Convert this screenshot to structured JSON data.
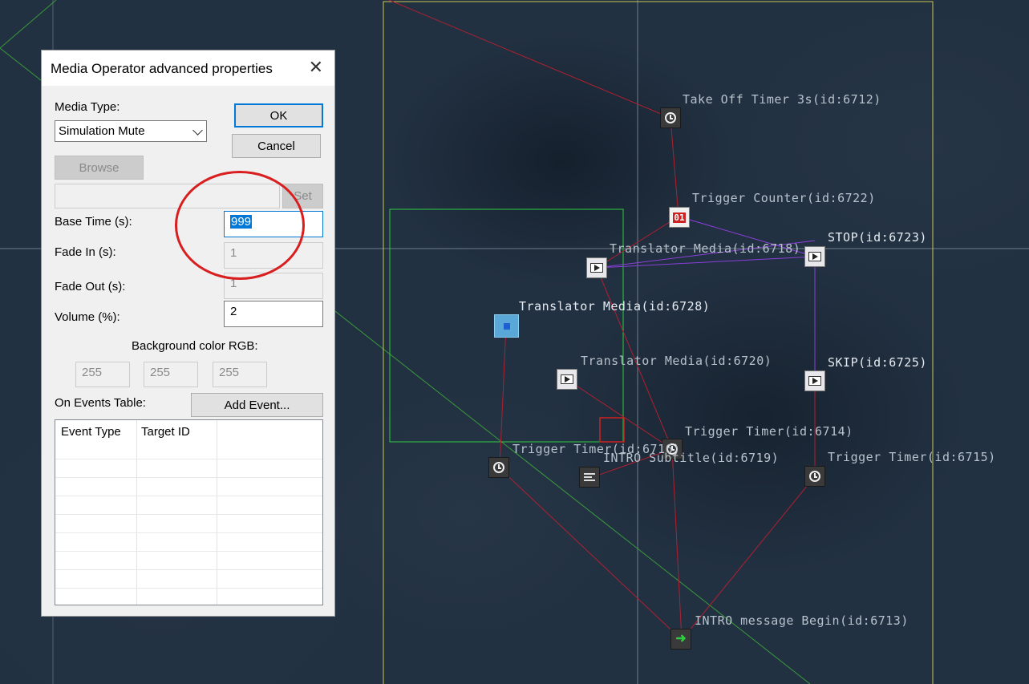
{
  "map": {
    "nodes": [
      {
        "name": "take-off-timer",
        "label": "Take Off Timer 3s(id:6712)",
        "icon": "timer-icon"
      },
      {
        "name": "trigger-counter",
        "label": "Trigger Counter(id:6722)",
        "icon": "counter-icon"
      },
      {
        "name": "translator-media-6718",
        "label": "Translator Media(id:6718)",
        "icon": "media-icon"
      },
      {
        "name": "stop",
        "label": "STOP(id:6723)",
        "icon": "media-icon"
      },
      {
        "name": "translator-media-6728",
        "label": "Translator Media(id:6728)",
        "icon": "media-selected-icon"
      },
      {
        "name": "translator-media-6720",
        "label": "Translator Media(id:6720)",
        "icon": "media-icon"
      },
      {
        "name": "skip",
        "label": "SKIP(id:6725)",
        "icon": "media-icon"
      },
      {
        "name": "trigger-timer-6714",
        "label": "Trigger Timer(id:6714)",
        "icon": "timer-icon"
      },
      {
        "name": "trigger-timer-6716",
        "label": "Trigger Timer(id:6716)",
        "icon": "timer-icon"
      },
      {
        "name": "intro-subtitle",
        "label": "INTRO Subtitle(id:6719)",
        "icon": "subtitle-icon"
      },
      {
        "name": "trigger-timer-6715",
        "label": "Trigger Timer(id:6715)",
        "icon": "timer-icon"
      },
      {
        "name": "intro-message-begin",
        "label": "INTRO message Begin(id:6713)",
        "icon": "entry-icon"
      }
    ],
    "counter_glyph": "01"
  },
  "dialog": {
    "title": "Media Operator advanced properties",
    "close_glyph": "✕",
    "media_type_label": "Media Type:",
    "media_type_value": "Simulation Mute",
    "ok_label": "OK",
    "cancel_label": "Cancel",
    "browse_label": "Browse",
    "path_value": "",
    "set_label": "Set",
    "base_time_label": "Base Time (s):",
    "base_time_value": "999",
    "fade_in_label": "Fade In (s):",
    "fade_in_value": "1",
    "fade_out_label": "Fade Out (s):",
    "fade_out_value": "1",
    "volume_label": "Volume (%):",
    "volume_value": "2",
    "bg_color_label": "Background color RGB:",
    "bg_r": "255",
    "bg_g": "255",
    "bg_b": "255",
    "events_label": "On Events Table:",
    "add_event_label": "Add Event...",
    "table_headers": [
      "Event Type",
      "Target ID"
    ]
  },
  "colors": {
    "annotation": "#d81e1e",
    "link_red": "#b02030",
    "link_purple": "#8a3fd8",
    "zone_yellow": "#c8c850",
    "zone_green": "#2ecc40",
    "accent": "#0078d7"
  }
}
